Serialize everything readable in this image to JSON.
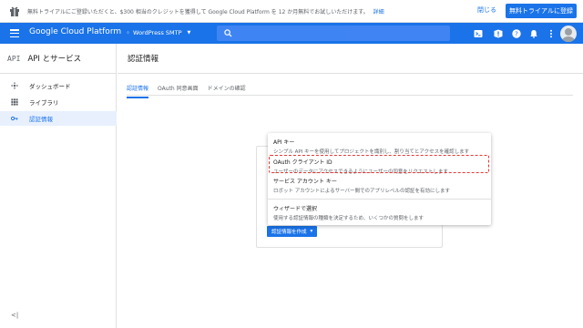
{
  "promo": {
    "message": "無料トライアルにご登録いただくと、$300 相当のクレジットを獲得して Google Cloud Platform を 12 か月無料でお試しいただけます。",
    "detail_link": "詳細",
    "close_label": "閉じる",
    "trial_button": "無料トライアルに登録"
  },
  "appbar": {
    "brand": "Google Cloud Platform",
    "project": "WordPress SMTP",
    "icons": [
      "cloud-shell-icon",
      "notifications-alert-icon",
      "help-icon",
      "bell-icon",
      "more-vert-icon"
    ],
    "accent": "#1a73e8"
  },
  "sidebar": {
    "badge": "API",
    "title": "API とサービス",
    "items": [
      {
        "label": "ダッシュボード",
        "icon": "dashboard-icon"
      },
      {
        "label": "ライブラリ",
        "icon": "library-icon"
      },
      {
        "label": "認証情報",
        "icon": "key-icon"
      }
    ],
    "collapse": "<|"
  },
  "main": {
    "title": "認証情報",
    "tabs": [
      "認証情報",
      "OAuth 同意画面",
      "ドメインの確認"
    ],
    "create_button": "認証情報を作成"
  },
  "menu": {
    "items": [
      {
        "title": "API キー",
        "desc": "シンプル API キーを使用してプロジェクトを識別し、割り当てとアクセスを確認します"
      },
      {
        "title": "OAuth クライアント ID",
        "desc": "ユーザーのデータにアクセスできるようにユーザーの同意をリクエストします"
      },
      {
        "title": "サービス アカウント キー",
        "desc": "ロボット アカウントによるサーバー間でのアプリレベルの認証を有効にします"
      },
      {
        "title": "ウィザードで選択",
        "desc": "使用する認証情報の種類を決定するため、いくつかの質問をします"
      }
    ],
    "highlight_color": "#e53935"
  }
}
